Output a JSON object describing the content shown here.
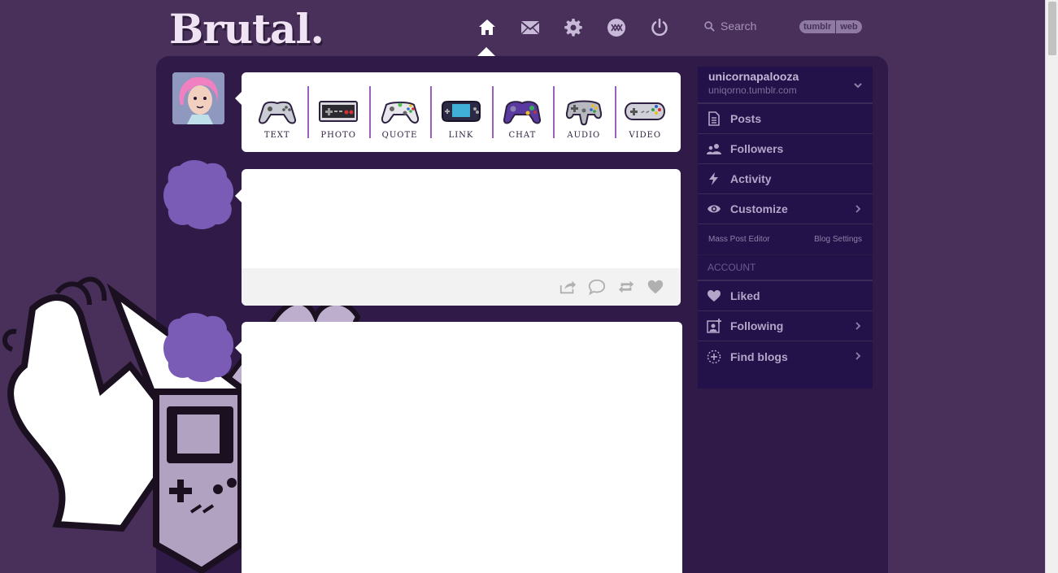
{
  "app": {
    "logo_text": "Brutal."
  },
  "topnav": {
    "items": [
      {
        "name": "home",
        "icon": "home-icon",
        "active": true
      },
      {
        "name": "messages",
        "icon": "mail-icon"
      },
      {
        "name": "settings",
        "icon": "gear-icon"
      },
      {
        "name": "xkit",
        "icon": "xkit-icon"
      },
      {
        "name": "logout",
        "icon": "power-icon"
      }
    ],
    "search_placeholder": "Search",
    "badge": [
      "tumblr",
      "web"
    ]
  },
  "post_types": [
    {
      "label": "TEXT",
      "icon": "ps-controller-icon"
    },
    {
      "label": "PHOTO",
      "icon": "nes-controller-icon"
    },
    {
      "label": "QUOTE",
      "icon": "xbox-controller-icon"
    },
    {
      "label": "LINK",
      "icon": "gameboy-advance-icon"
    },
    {
      "label": "CHAT",
      "icon": "gamecube-controller-icon"
    },
    {
      "label": "AUDIO",
      "icon": "n64-controller-icon"
    },
    {
      "label": "VIDEO",
      "icon": "snes-controller-icon"
    }
  ],
  "sidebar": {
    "blog_name": "unicornapalooza",
    "blog_url": "uniqorno.tumblr.com",
    "items": [
      {
        "label": "Posts",
        "icon": "document-icon"
      },
      {
        "label": "Followers",
        "icon": "people-icon"
      },
      {
        "label": "Activity",
        "icon": "lightning-icon"
      },
      {
        "label": "Customize",
        "icon": "eye-icon"
      }
    ],
    "sub_links": [
      "Mass Post Editor",
      "Blog Settings"
    ],
    "account_heading": "ACCOUNT",
    "account_items": [
      {
        "label": "Liked",
        "icon": "heart-icon"
      },
      {
        "label": "Following",
        "icon": "add-person-icon"
      },
      {
        "label": "Find blogs",
        "icon": "compass-icon"
      }
    ]
  },
  "colors": {
    "background": "#48305b",
    "panel": "#301a48",
    "sidebar": "#23114a",
    "accent": "#9b5fbf",
    "blob": "#7a5bb5"
  }
}
